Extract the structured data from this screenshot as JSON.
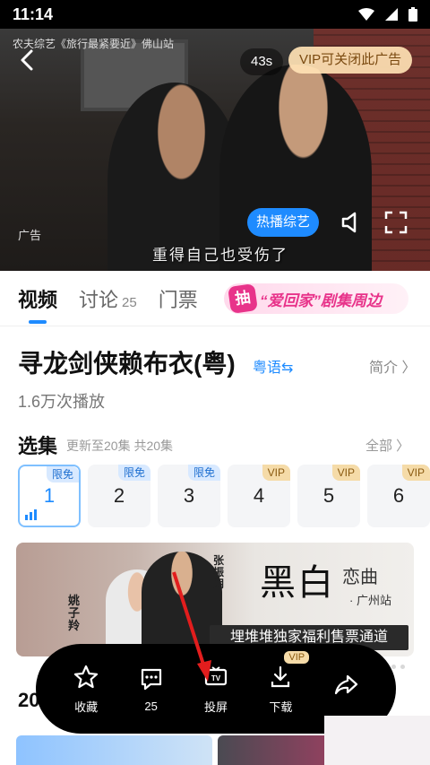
{
  "status_bar": {
    "time": "11:14"
  },
  "video": {
    "top_line": "农夫综艺《旅行最紧要近》佛山站",
    "countdown": "43s",
    "vip_close": "VIP可关闭此广告",
    "ad_label": "广告",
    "subtitle": "重得自己也受伤了",
    "hot_button": "热播综艺"
  },
  "tabs": [
    {
      "label": "视频",
      "active": true
    },
    {
      "label": "讨论",
      "count": "25"
    },
    {
      "label": "门票"
    }
  ],
  "promo": {
    "catch": "抽",
    "text": "“爱回家”剧集周边"
  },
  "show": {
    "title": "寻龙剑侠赖布衣(粤)",
    "dialect": "粤语⇆",
    "intro": "简介 〉",
    "plays": "1.6万次播放"
  },
  "episodes": {
    "heading": "选集",
    "update": "更新至20集 共20集",
    "all": "全部 〉",
    "items": [
      {
        "num": "1",
        "badge": "限免",
        "type": "free"
      },
      {
        "num": "2",
        "badge": "限免",
        "type": "free"
      },
      {
        "num": "3",
        "badge": "限免",
        "type": "free"
      },
      {
        "num": "4",
        "badge": "VIP",
        "type": "vip"
      },
      {
        "num": "5",
        "badge": "VIP",
        "type": "vip"
      },
      {
        "num": "6",
        "badge": "VIP",
        "type": "vip"
      }
    ]
  },
  "banner": {
    "name1": "姚子羚",
    "name2": "张振朗",
    "big": "黑白",
    "small": "恋曲",
    "city": "· 广州站",
    "bar": "埋堆堆独家福利售票通道"
  },
  "next_section_heading": "20",
  "actionbar": {
    "collect": "收藏",
    "comments": "25",
    "cast": "投屏",
    "download": "下载",
    "vip_badge": "VIP"
  },
  "colors": {
    "accent": "#1e8bff",
    "vip": "#f5dba8",
    "promo": "#e8338a"
  }
}
